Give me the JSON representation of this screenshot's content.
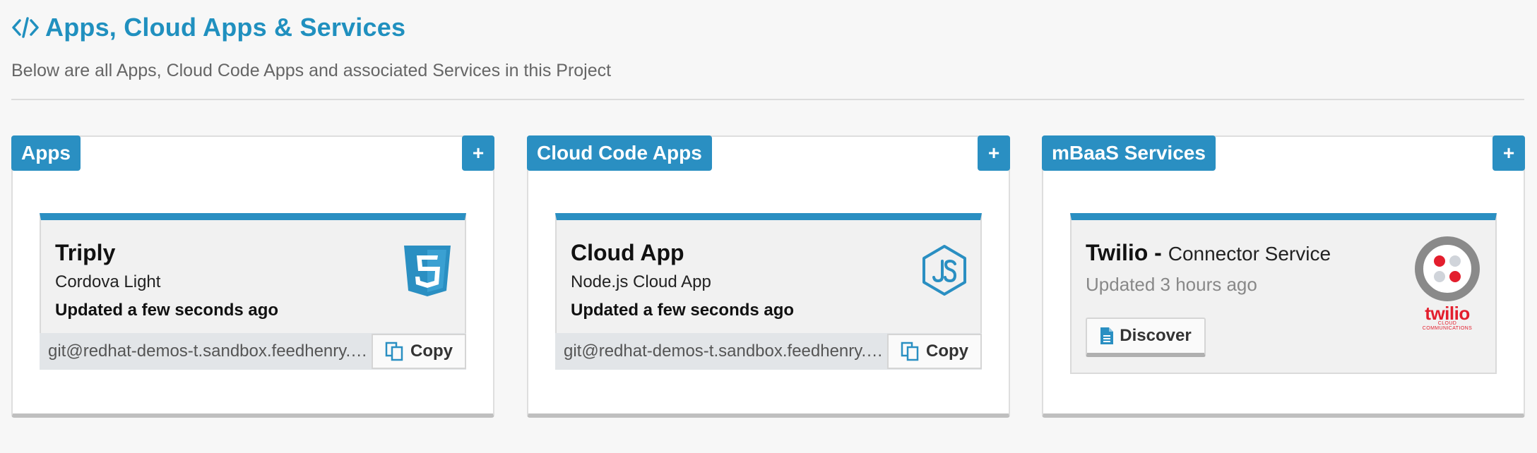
{
  "header": {
    "title": "Apps, Cloud Apps & Services",
    "subtitle": "Below are all Apps, Cloud Code Apps and associated Services in this Project"
  },
  "panels": [
    {
      "label": "Apps",
      "add_label": "+",
      "card": {
        "name": "Triply",
        "type": "Cordova Light",
        "updated": "Updated a few seconds ago",
        "git_url": "git@redhat-demos-t.sandbox.feedhenry.com:redhat-demos-t/Triply-Triply.git",
        "copy_label": "Copy",
        "icon": "html5-icon"
      }
    },
    {
      "label": "Cloud Code Apps",
      "add_label": "+",
      "card": {
        "name": "Cloud App",
        "type": "Node.js Cloud App",
        "updated": "Updated a few seconds ago",
        "git_url": "git@redhat-demos-t.sandbox.feedhenry.com:redhat-demos-t/Triply-Cloud-App.git",
        "copy_label": "Copy",
        "icon": "nodejs-icon"
      }
    },
    {
      "label": "mBaaS Services",
      "add_label": "+",
      "card": {
        "name": "Twilio",
        "separator": "-",
        "kind": "Connector Service",
        "updated": "Updated 3 hours ago",
        "discover_label": "Discover",
        "logo_word": "twilio",
        "logo_tagline": "CLOUD COMMUNICATIONS",
        "icon": "twilio-logo"
      }
    }
  ],
  "colors": {
    "accent": "#2a8fc2",
    "title": "#2090bf",
    "twilio_red": "#e31e2d"
  }
}
